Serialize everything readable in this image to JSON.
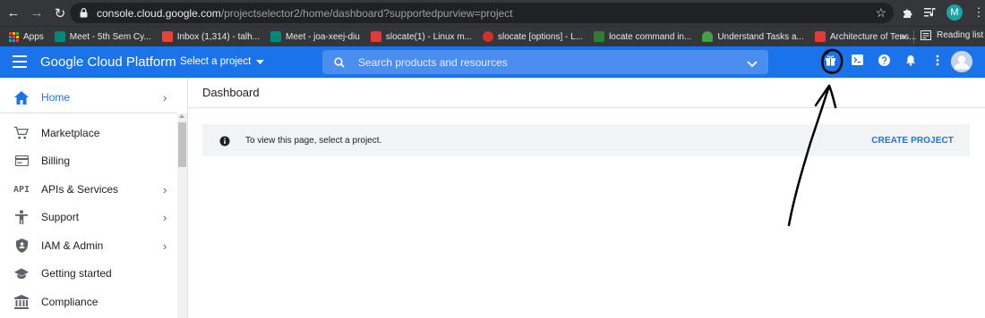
{
  "browser": {
    "url_host": "console.cloud.google.com",
    "url_path": "/projectselector2/home/dashboard?supportedpurview=project",
    "profile_initial": "M",
    "bookmarks": [
      {
        "label": "Apps",
        "color": "#ea4335"
      },
      {
        "label": "Meet - 5th Sem Cy...",
        "color": "#00897b"
      },
      {
        "label": "Inbox (1,314) - talh...",
        "color": "#ea4335"
      },
      {
        "label": "Meet - joa-xeej-diu",
        "color": "#00897b"
      },
      {
        "label": "slocate(1) - Linux m...",
        "color": "#e53935"
      },
      {
        "label": "slocate [options] - L...",
        "color": "#d32f2f"
      },
      {
        "label": "locate command in...",
        "color": "#2e7d32"
      },
      {
        "label": "Understand Tasks a...",
        "color": "#43a047"
      },
      {
        "label": "Architecture of Tens...",
        "color": "#e53935"
      }
    ],
    "more_label": "»",
    "reading_list": "Reading list"
  },
  "gcp": {
    "title": "Google Cloud Platform",
    "project_selector": "Select a project",
    "search_placeholder": "Search products and resources"
  },
  "sidebar": {
    "items": [
      {
        "label": "Home",
        "icon": "home-icon",
        "chevron": true,
        "active": true
      },
      {
        "label": "Marketplace",
        "icon": "cart-icon",
        "chevron": false
      },
      {
        "label": "Billing",
        "icon": "billing-icon",
        "chevron": false
      },
      {
        "label": "APIs & Services",
        "icon": "api-icon",
        "chevron": true
      },
      {
        "label": "Support",
        "icon": "support-icon",
        "chevron": true
      },
      {
        "label": "IAM & Admin",
        "icon": "shield-icon",
        "chevron": true
      },
      {
        "label": "Getting started",
        "icon": "graduation-icon",
        "chevron": false
      },
      {
        "label": "Compliance",
        "icon": "bank-icon",
        "chevron": false
      }
    ]
  },
  "main": {
    "title": "Dashboard",
    "notice_text": "To view this page, select a project.",
    "create_project": "CREATE PROJECT"
  },
  "colors": {
    "brand_blue": "#1a73e8",
    "chrome_dark": "#35363a",
    "annotation": "#000000"
  }
}
